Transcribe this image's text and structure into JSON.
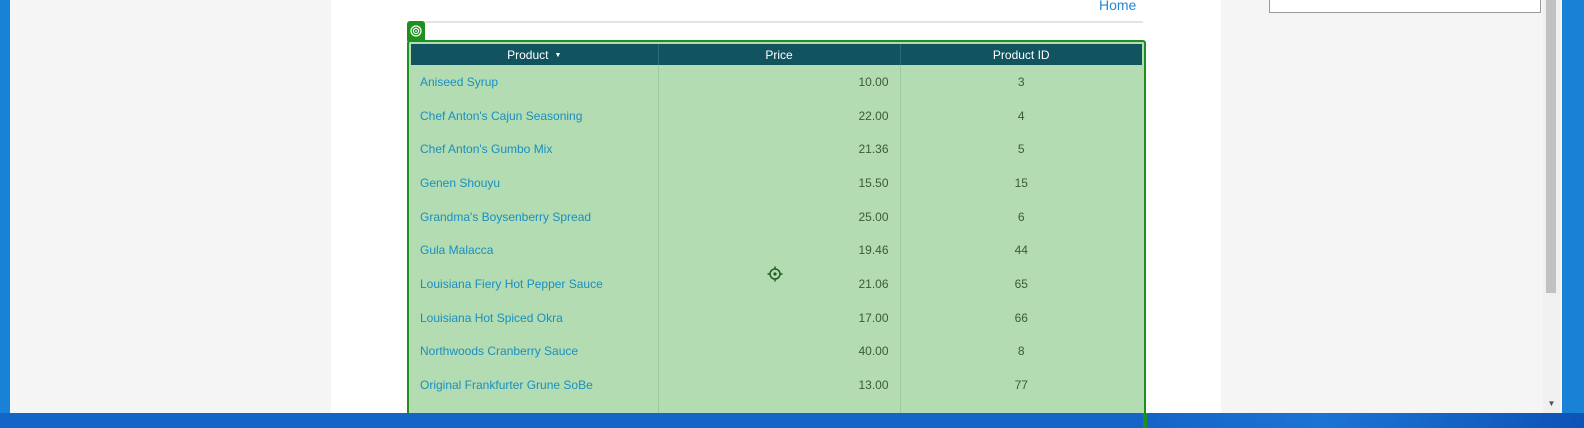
{
  "nav": {
    "home_label": "Home"
  },
  "grid": {
    "columns": [
      {
        "label": "Product",
        "sorted": "descending"
      },
      {
        "label": "Price"
      },
      {
        "label": "Product ID"
      }
    ],
    "rows": [
      {
        "product": "Aniseed Syrup",
        "price": "10.00",
        "id": "3"
      },
      {
        "product": "Chef Anton's Cajun Seasoning",
        "price": "22.00",
        "id": "4"
      },
      {
        "product": "Chef Anton's Gumbo Mix",
        "price": "21.36",
        "id": "5"
      },
      {
        "product": "Genen Shouyu",
        "price": "15.50",
        "id": "15"
      },
      {
        "product": "Grandma's Boysenberry Spread",
        "price": "25.00",
        "id": "6"
      },
      {
        "product": "Gula Malacca",
        "price": "19.46",
        "id": "44"
      },
      {
        "product": "Louisiana Fiery Hot Pepper Sauce",
        "price": "21.06",
        "id": "65"
      },
      {
        "product": "Louisiana Hot Spiced Okra",
        "price": "17.00",
        "id": "66"
      },
      {
        "product": "Northwoods Cranberry Sauce",
        "price": "40.00",
        "id": "8"
      },
      {
        "product": "Original Frankfurter Grune SoBe",
        "price": "13.00",
        "id": "77"
      }
    ]
  },
  "colors": {
    "header_bg": "#11545f",
    "highlight_bg": "#b3dcb3",
    "highlight_border": "#1f8f1f",
    "link": "#1a8fbf",
    "frame": "#1a82d6"
  },
  "icons": {
    "grid_badge": "target-circle-icon",
    "crosshair": "crosshair-icon",
    "sort": "caret-down-icon",
    "scroll_down": "scroll-down-arrow-icon"
  }
}
